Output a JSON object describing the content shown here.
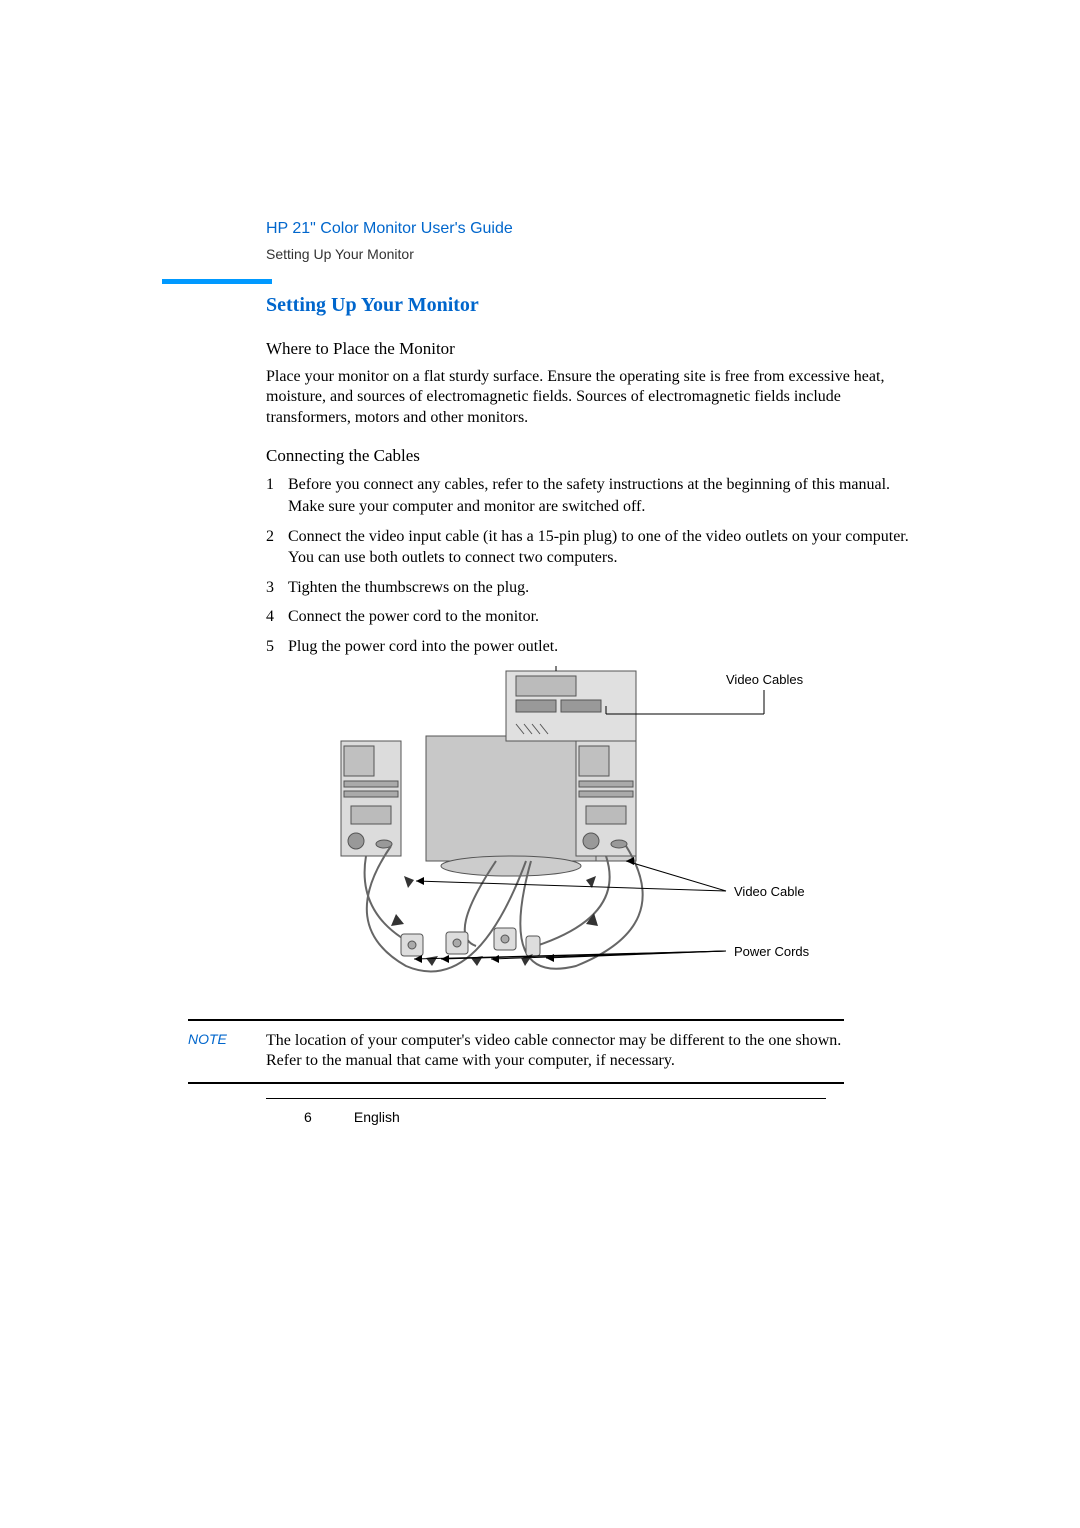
{
  "header": {
    "doc_title": "HP 21\" Color Monitor User's Guide",
    "breadcrumb": "Setting Up Your Monitor"
  },
  "content": {
    "section_title": "Setting Up Your Monitor",
    "sub1_title": "Where to Place the Monitor",
    "sub1_para": "Place your monitor on a flat sturdy surface. Ensure the operating site is free from excessive heat, moisture, and sources of electromagnetic fields. Sources of electromagnetic fields include transformers, motors and other monitors.",
    "sub2_title": "Connecting the Cables",
    "steps": [
      {
        "n": "1",
        "t": "Before you connect any cables, refer to the safety instructions at the beginning of this manual. Make sure your computer and monitor are switched off."
      },
      {
        "n": "2",
        "t": "Connect the video input cable (it has a 15-pin plug) to one of the video outlets on your computer. You can use both outlets to connect two computers."
      },
      {
        "n": "3",
        "t": "Tighten the thumbscrews on the plug."
      },
      {
        "n": "4",
        "t": "Connect the power cord to the monitor."
      },
      {
        "n": "5",
        "t": "Plug the power cord into the power outlet."
      }
    ],
    "figure": {
      "lbl_video_cables": "Video Cables",
      "lbl_video_cable": "Video Cable",
      "lbl_power_cords": "Power Cords"
    },
    "note_label": "NOTE",
    "note_text": "The location of your computer's video cable connector may be different to the one shown. Refer to the manual that came with your computer, if necessary."
  },
  "footer": {
    "page_num": "6",
    "lang": "English"
  }
}
